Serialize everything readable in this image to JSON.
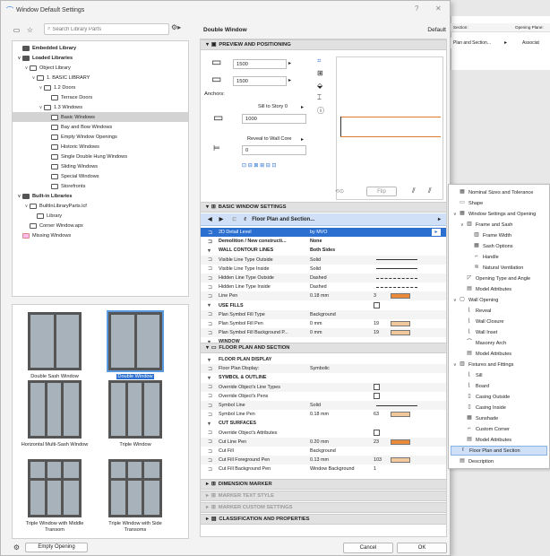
{
  "window": {
    "title": "Window Default Settings",
    "help_glyph": "?",
    "close_glyph": "✕"
  },
  "library": {
    "search_placeholder": "Search Library Parts",
    "tree": [
      {
        "label": "Embedded Library",
        "level": 0,
        "chev": "",
        "bold": true,
        "icon": "filled"
      },
      {
        "label": "Loaded Libraries",
        "level": 0,
        "chev": "∨",
        "bold": true,
        "icon": "filled"
      },
      {
        "label": "Object Library",
        "level": 1,
        "chev": "∨",
        "bold": false,
        "icon": "folder"
      },
      {
        "label": "1. BASIC LIBRARY",
        "level": 2,
        "chev": "∨",
        "bold": false,
        "icon": "folder"
      },
      {
        "label": "1.2 Doors",
        "level": 3,
        "chev": "∨",
        "bold": false,
        "icon": "folder"
      },
      {
        "label": "Terrace Doors",
        "level": 4,
        "chev": "",
        "bold": false,
        "icon": "folder"
      },
      {
        "label": "1.3 Windows",
        "level": 3,
        "chev": "∨",
        "bold": false,
        "icon": "folder"
      },
      {
        "label": "Basic Windows",
        "level": 4,
        "chev": "",
        "bold": false,
        "icon": "folder",
        "selected": true
      },
      {
        "label": "Bay and Bow Windows",
        "level": 4,
        "chev": "",
        "bold": false,
        "icon": "folder"
      },
      {
        "label": "Empty Window Openings",
        "level": 4,
        "chev": "",
        "bold": false,
        "icon": "folder"
      },
      {
        "label": "Historic Windows",
        "level": 4,
        "chev": "",
        "bold": false,
        "icon": "folder"
      },
      {
        "label": "Single Double Hung Windows",
        "level": 4,
        "chev": "",
        "bold": false,
        "icon": "folder"
      },
      {
        "label": "Sliding Windows",
        "level": 4,
        "chev": "",
        "bold": false,
        "icon": "folder"
      },
      {
        "label": "Special Windows",
        "level": 4,
        "chev": "",
        "bold": false,
        "icon": "folder"
      },
      {
        "label": "Storefronts",
        "level": 4,
        "chev": "",
        "bold": false,
        "icon": "folder"
      },
      {
        "label": "Built-in Libraries",
        "level": 0,
        "chev": "∨",
        "bold": true,
        "icon": "filled"
      },
      {
        "label": "BuiltInLibraryParts.lcf",
        "level": 1,
        "chev": "∨",
        "bold": false,
        "icon": "folder"
      },
      {
        "label": "Library",
        "level": 2,
        "chev": "",
        "bold": false,
        "icon": "folder"
      },
      {
        "label": "Corner Window.apx",
        "level": 1,
        "chev": "",
        "bold": false,
        "icon": "folder"
      },
      {
        "label": "Missing Windows",
        "level": 0,
        "chev": "",
        "bold": false,
        "icon": "pink"
      }
    ],
    "thumbnails": [
      {
        "label": "Double Sash Window",
        "selected": false
      },
      {
        "label": "Double Window",
        "selected": true
      },
      {
        "label": "Horizontal Multi-Sash Window",
        "selected": false
      },
      {
        "label": "Triple Window",
        "selected": false
      },
      {
        "label": "Triple Window with Middle Transom",
        "selected": false
      },
      {
        "label": "Triple Window with Side Transoms",
        "selected": false
      }
    ],
    "empty_opening_label": "Empty Opening"
  },
  "settings": {
    "title": "Double Window",
    "default_label": "Default",
    "preview_section": "PREVIEW AND POSITIONING",
    "width": "1500",
    "height": "1500",
    "anchors_label": "Anchors:",
    "sill_label": "Sill to Story 0",
    "sill_value": "1000",
    "reveal_label": "Reveal to Wall Core",
    "reveal_value": "0",
    "flip_label": "Flip",
    "basic_section": "BASIC WINDOW SETTINGS",
    "page_selector": "Floor Plan and Section...",
    "rows": [
      {
        "name": "2D Detail Level",
        "value": "by MVO",
        "col3": "",
        "kind": "hl"
      },
      {
        "name": "Demolition / New constructi...",
        "value": "None",
        "col3": "",
        "kind": "bold"
      },
      {
        "name": "WALL CONTOUR LINES",
        "value": "Both Sides",
        "col3": "",
        "kind": "subhead"
      },
      {
        "name": "Visible Line Type Outside",
        "value": "Solid",
        "col3": "",
        "kind": "line"
      },
      {
        "name": "Visible Line Type Inside",
        "value": "Solid",
        "col3": "",
        "kind": "line"
      },
      {
        "name": "Hidden Line Type Outside",
        "value": "Dashed",
        "col3": "",
        "kind": "dash"
      },
      {
        "name": "Hidden Line Type Inside",
        "value": "Dashed",
        "col3": "",
        "kind": "dash"
      },
      {
        "name": "Line Pen",
        "value": "0.18 mm",
        "col3": "3",
        "kind": "pen"
      },
      {
        "name": "USE FILLS",
        "value": "",
        "col3": "",
        "kind": "subcheck"
      },
      {
        "name": "Plan Symbol Fill Type",
        "value": "Background",
        "col3": "",
        "kind": "plain"
      },
      {
        "name": "Plan Symbol Fill Pen",
        "value": "0 mm",
        "col3": "19",
        "kind": "penlight"
      },
      {
        "name": "Plan Symbol Fill Background P...",
        "value": "0 mm",
        "col3": "19",
        "kind": "penlight"
      },
      {
        "name": "WINDOW",
        "value": "",
        "col3": "",
        "kind": "subhead"
      }
    ],
    "floor_section": "FLOOR PLAN AND SECTION",
    "floor_rows": [
      {
        "name": "FLOOR PLAN DISPLAY",
        "value": "",
        "col3": "",
        "kind": "subhead"
      },
      {
        "name": "Floor Plan Display:",
        "value": "Symbolic",
        "col3": "",
        "kind": "plain"
      },
      {
        "name": "SYMBOL & OUTLINE",
        "value": "",
        "col3": "",
        "kind": "subhead"
      },
      {
        "name": "Override Object's Line Types",
        "value": "",
        "col3": "",
        "kind": "check"
      },
      {
        "name": "Override Object's Pens",
        "value": "",
        "col3": "",
        "kind": "check"
      },
      {
        "name": "Symbol Line",
        "value": "Solid",
        "col3": "",
        "kind": "line"
      },
      {
        "name": "Symbol Line Pen",
        "value": "0.18 mm",
        "col3": "63",
        "kind": "penlight"
      },
      {
        "name": "CUT SURFACES",
        "value": "",
        "col3": "",
        "kind": "subhead"
      },
      {
        "name": "Override Object's Attributes",
        "value": "",
        "col3": "",
        "kind": "check"
      },
      {
        "name": "Cut Line Pen",
        "value": "0.20 mm",
        "col3": "23",
        "kind": "pen"
      },
      {
        "name": "Cut Fill",
        "value": "Background",
        "col3": "",
        "kind": "plain"
      },
      {
        "name": "Cut Fill Foreground Pen",
        "value": "0.13 mm",
        "col3": "103",
        "kind": "penlight"
      },
      {
        "name": "Cut Fill Background Pen",
        "value": "Window Background",
        "col3": "1",
        "kind": "plain"
      }
    ],
    "dimension_section": "DIMENSION MARKER",
    "marker_text_section": "MARKER TEXT STYLE",
    "marker_custom_section": "MARKER CUSTOM SETTINGS",
    "classification_section": "CLASSIFICATION AND PROPERTIES",
    "cancel_label": "Cancel",
    "ok_label": "OK"
  },
  "background_table": {
    "col1": "Section:",
    "col2": "Opening Plane:",
    "row_value": "Plan and Section...",
    "row_value2": "Associat"
  },
  "popup": {
    "items": [
      {
        "label": "Nominal Sizes and Tolerance",
        "level": 0,
        "chev": "",
        "icon": "▦"
      },
      {
        "label": "Shape",
        "level": 0,
        "chev": "",
        "icon": "▭"
      },
      {
        "label": "Window Settings and Opening",
        "level": 0,
        "chev": "∨",
        "icon": "▦"
      },
      {
        "label": "Frame and Sash",
        "level": 1,
        "chev": "∨",
        "icon": "▥"
      },
      {
        "label": "Frame Width",
        "level": 2,
        "chev": "",
        "icon": "▥"
      },
      {
        "label": "Sash Options",
        "level": 2,
        "chev": "",
        "icon": "▦"
      },
      {
        "label": "Handle",
        "level": 2,
        "chev": "",
        "icon": "⌐"
      },
      {
        "label": "Natural Ventilation",
        "level": 2,
        "chev": "",
        "icon": "≋"
      },
      {
        "label": "Opening Type and Angle",
        "level": 1,
        "chev": "",
        "icon": "◸"
      },
      {
        "label": "Model Attributes",
        "level": 1,
        "chev": "",
        "icon": "▤"
      },
      {
        "label": "Wall Opening",
        "level": 0,
        "chev": "∨",
        "icon": "▢"
      },
      {
        "label": "Reveal",
        "level": 1,
        "chev": "",
        "icon": "⌊"
      },
      {
        "label": "Wall Closure",
        "level": 1,
        "chev": "",
        "icon": "⌊"
      },
      {
        "label": "Wall Inset",
        "level": 1,
        "chev": "",
        "icon": "⌊"
      },
      {
        "label": "Masonry Arch",
        "level": 1,
        "chev": "",
        "icon": "⌒"
      },
      {
        "label": "Model Attributes",
        "level": 1,
        "chev": "",
        "icon": "▤"
      },
      {
        "label": "Fixtures and Fittings",
        "level": 0,
        "chev": "∨",
        "icon": "▥"
      },
      {
        "label": "Sill",
        "level": 1,
        "chev": "",
        "icon": "⌊"
      },
      {
        "label": "Board",
        "level": 1,
        "chev": "",
        "icon": "⌊"
      },
      {
        "label": "Casing Outside",
        "level": 1,
        "chev": "",
        "icon": "▯"
      },
      {
        "label": "Casing Inside",
        "level": 1,
        "chev": "",
        "icon": "▯"
      },
      {
        "label": "Sunshade",
        "level": 1,
        "chev": "",
        "icon": "▦"
      },
      {
        "label": "Custom Corner",
        "level": 1,
        "chev": "",
        "icon": "⌐"
      },
      {
        "label": "Model Attributes",
        "level": 1,
        "chev": "",
        "icon": "▤"
      },
      {
        "label": "Floor Plan and Section",
        "level": 0,
        "chev": "",
        "icon": "ℓ",
        "selected": true
      },
      {
        "label": "Description",
        "level": 0,
        "chev": "",
        "icon": "▤"
      }
    ]
  },
  "colors": {
    "accent": "#2b6fd1",
    "pen_orange": "#ec8a3c",
    "selection": "#d3d3d3"
  }
}
